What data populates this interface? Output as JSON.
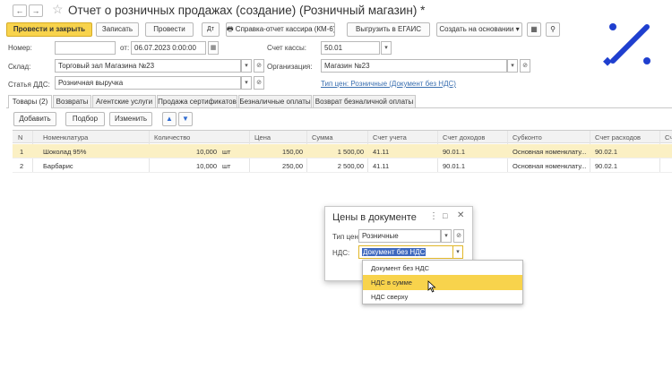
{
  "window": {
    "title": "Отчет о розничных продажах (создание) (Розничный магазин) *"
  },
  "toolbar": {
    "post_close": "Провести и закрыть",
    "save": "Записать",
    "post": "Провести",
    "cashier_report": "Справка-отчет кассира (КМ-6)",
    "upload_egais": "Выгрузить в ЕГАИС",
    "create_based": "Создать на основании"
  },
  "form": {
    "number_label": "Номер:",
    "number_value": "",
    "date_label": "от:",
    "date_value": "06.07.2023  0:00:00",
    "cash_label": "Счет кассы:",
    "cash_value": "50.01",
    "warehouse_label": "Склад:",
    "warehouse_value": "Торговый зал Магазина №23",
    "org_label": "Организация:",
    "org_value": "Магазин №23",
    "dds_label": "Статья ДДС:",
    "dds_value": "Розничная выручка",
    "price_type_link": "Тип цен: Розничные (Документ без НДС)"
  },
  "tabs": [
    "Товары (2)",
    "Возвраты",
    "Агентские услуги",
    "Продажа сертификатов",
    "Безналичные оплаты",
    "Возврат безналичной оплаты"
  ],
  "table_toolbar": {
    "add": "Добавить",
    "select": "Подбор",
    "edit": "Изменить"
  },
  "table": {
    "columns": [
      "N",
      "Номенклатура",
      "Количество",
      "Цена",
      "Сумма",
      "Счет учета",
      "Счет доходов",
      "Субконто",
      "Счет расходов",
      "Сч"
    ],
    "rows": [
      {
        "n": "1",
        "item": "Шоколад 95%",
        "qty": "10,000",
        "unit": "шт",
        "price": "150,00",
        "sum": "1 500,00",
        "acc": "41.11",
        "income": "90.01.1",
        "subconto": "Основная номенклату...",
        "expense": "90.02.1"
      },
      {
        "n": "2",
        "item": "Барбарис",
        "qty": "10,000",
        "unit": "шт",
        "price": "250,00",
        "sum": "2 500,00",
        "acc": "41.11",
        "income": "90.01.1",
        "subconto": "Основная номенклату...",
        "expense": "90.02.1"
      }
    ]
  },
  "dialog": {
    "title": "Цены в документе",
    "price_type_label": "Тип цен:",
    "price_type_value": "Розничные",
    "vat_label": "НДС:",
    "vat_value": "Документ без НДС"
  },
  "vat_dropdown": {
    "options": [
      "Документ без НДС",
      "НДС в сумме",
      "НДС сверху"
    ],
    "highlighted": 1
  },
  "colors": {
    "accent": "#f8d34c",
    "logo": "#1f3fcf",
    "link": "#3a6fb0"
  }
}
